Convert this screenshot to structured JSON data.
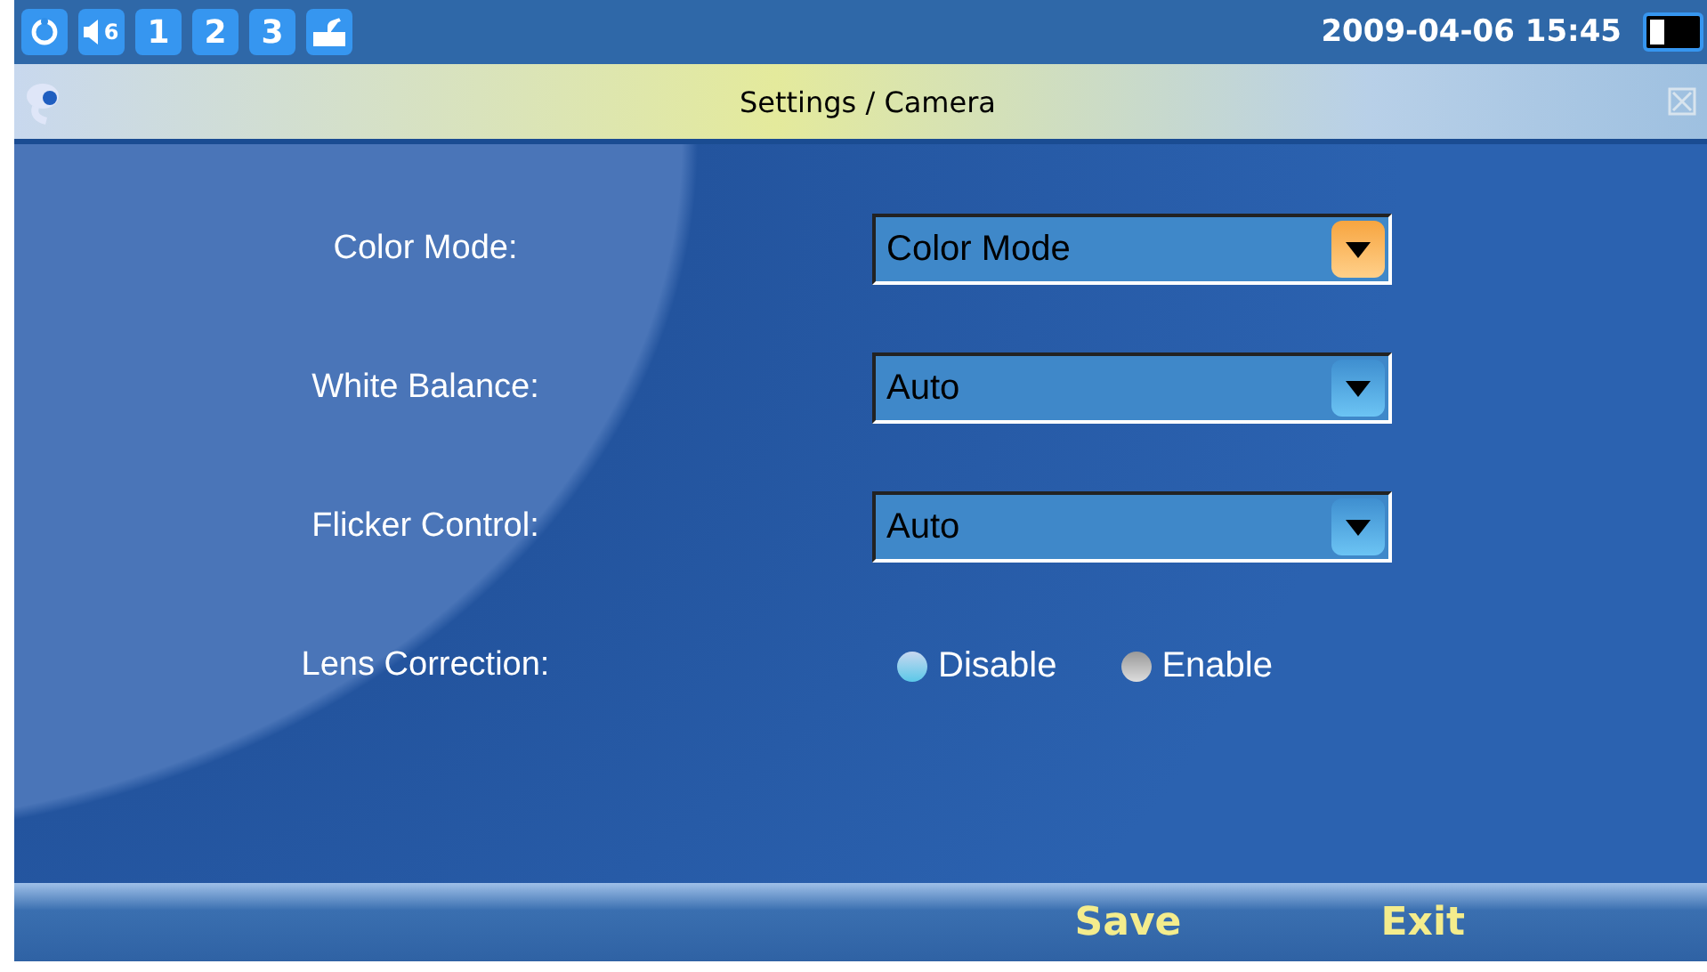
{
  "status_bar": {
    "volume": "6",
    "lines": [
      {
        "label": "1"
      },
      {
        "label": "2"
      },
      {
        "label": "3"
      }
    ],
    "datetime": "2009-04-06 15:45"
  },
  "window": {
    "title": "Settings / Camera"
  },
  "fields": [
    {
      "kind": "dropdown",
      "label": "Color Mode:",
      "value": "Color Mode",
      "focused": true
    },
    {
      "kind": "dropdown",
      "label": "White Balance:",
      "value": "Auto",
      "focused": false
    },
    {
      "kind": "dropdown",
      "label": "Flicker Control:",
      "value": "Auto",
      "focused": false
    },
    {
      "kind": "radio",
      "label": "Lens Correction:",
      "options": [
        {
          "label": "Disable",
          "selected": true
        },
        {
          "label": "Enable",
          "selected": false
        }
      ]
    }
  ],
  "buttons": [
    "Save",
    "Exit"
  ]
}
